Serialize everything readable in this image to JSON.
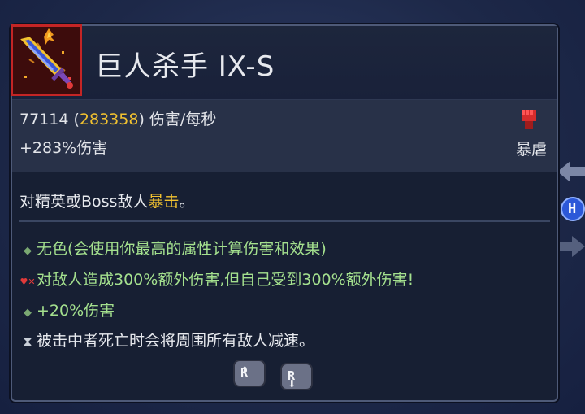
{
  "item": {
    "name": "巨人杀手 IX-S",
    "icon": "giant-killer-sword-icon"
  },
  "stats": {
    "dps": "77114",
    "dps_crit_open": "(",
    "dps_crit": "283358",
    "dps_crit_close": ")",
    "dps_unit": "伤害/每秒",
    "bonus": "+283%伤害",
    "tag_label": "暴虐",
    "tag_icon": "fist-icon"
  },
  "description": {
    "prefix": "对精英或Boss敌人",
    "highlight": "暴击",
    "suffix": "。"
  },
  "affixes": [
    {
      "icon": "diamond-bullet-icon",
      "text": "无色(会使用你最高的属性计算伤害和效果)"
    },
    {
      "icon": "curse-icon",
      "text": "对敌人造成300%额外伤害,但自己受到300%额外伤害!"
    },
    {
      "icon": "diamond-bullet-icon",
      "text": "+20%伤害"
    },
    {
      "icon": "hourglass-icon",
      "text": "被击中者死亡时会将周围所有敌人减速。"
    }
  ],
  "buttons": {
    "scroll_up_label": "R",
    "scroll_down_label": "R"
  },
  "side": {
    "badge_label": "H"
  },
  "colors": {
    "accent_gold": "#f2c230",
    "affix_green": "#a4e08e",
    "icon_border": "#c42525"
  }
}
